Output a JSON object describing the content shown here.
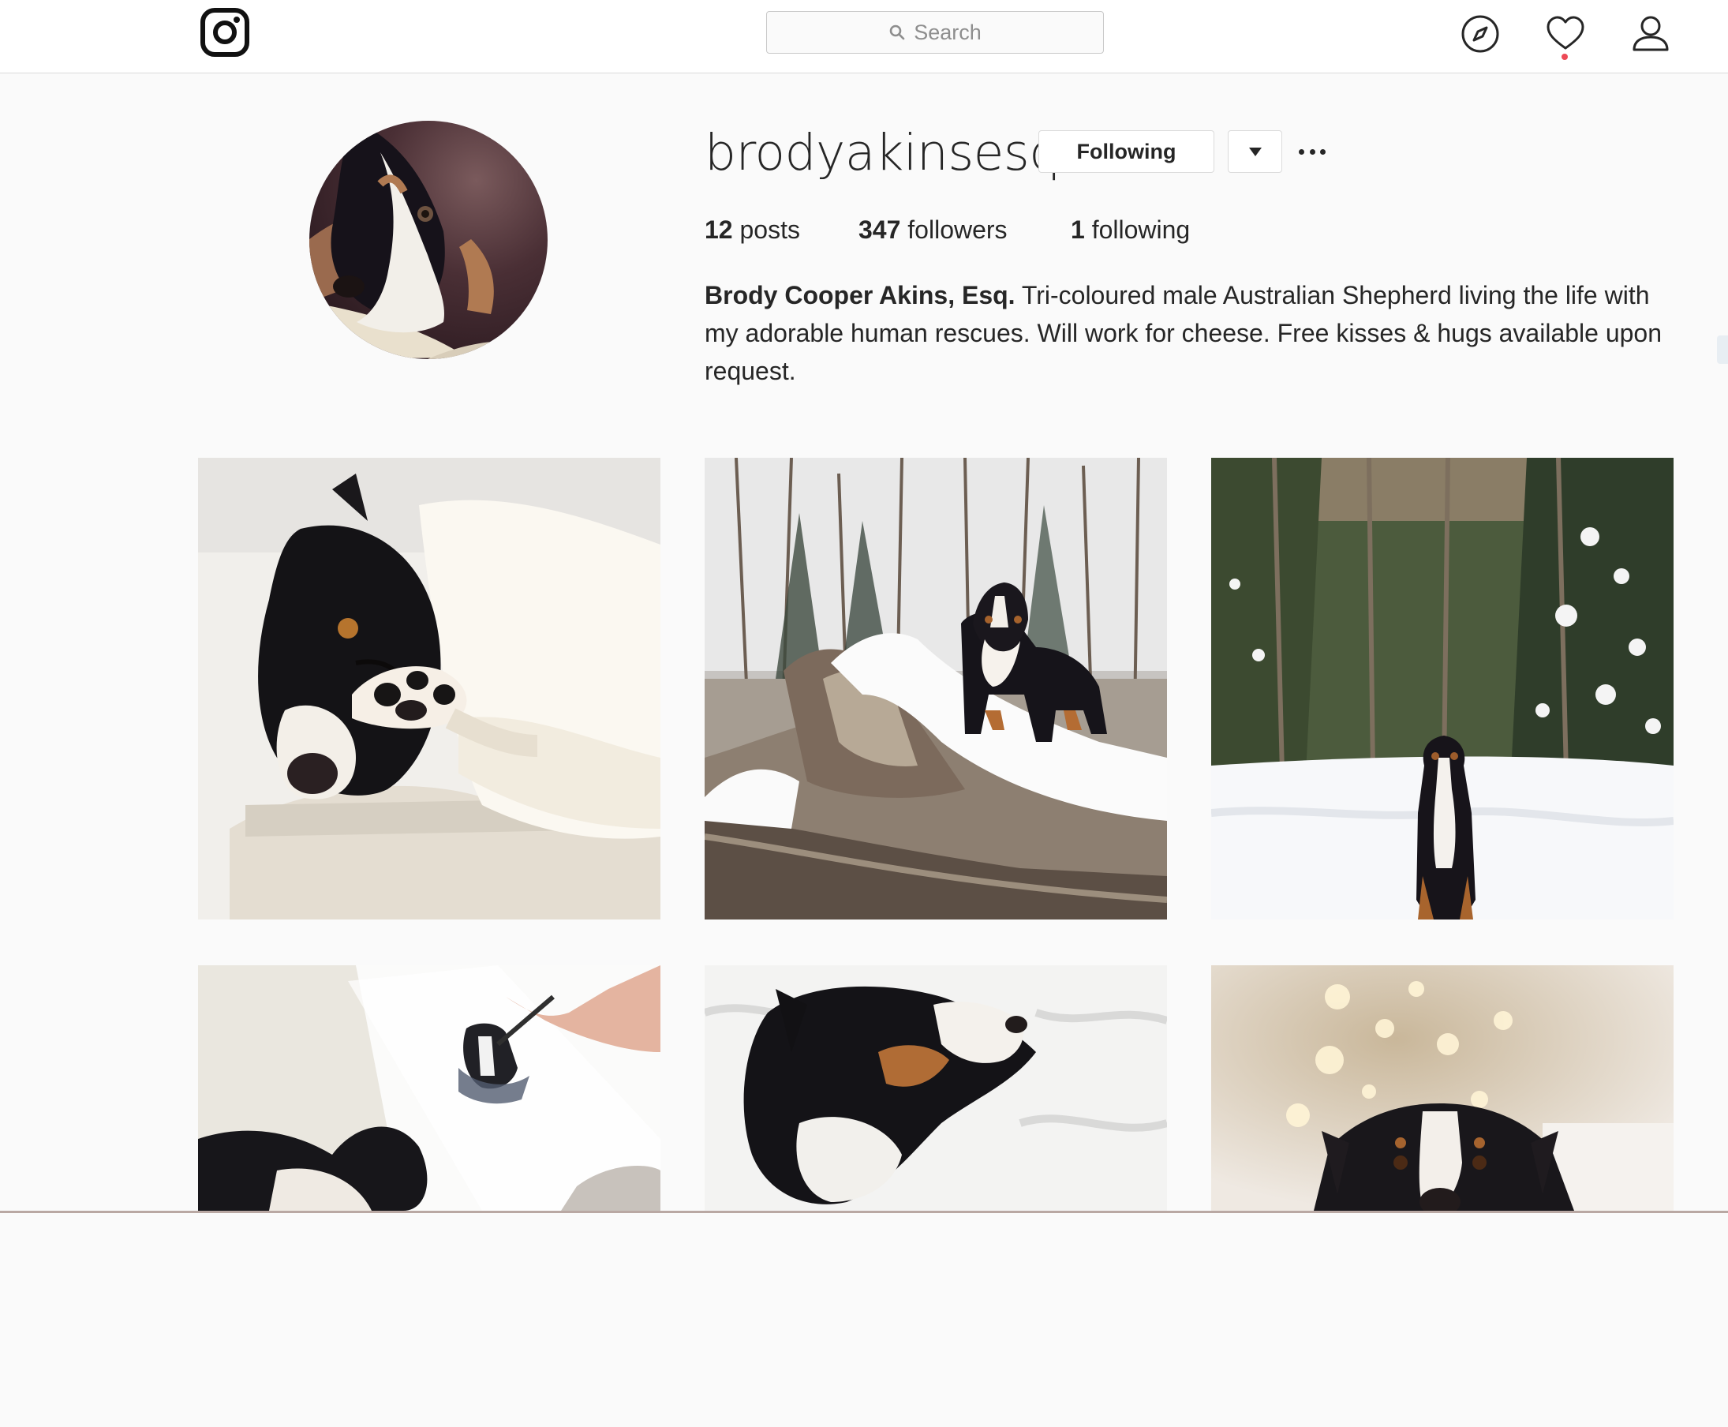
{
  "nav": {
    "search_placeholder": "Search",
    "logo_icon": "instagram-logo-icon",
    "icons": [
      "compass-icon",
      "heart-icon",
      "user-icon"
    ],
    "has_notification": true
  },
  "profile": {
    "username": "brodyakinsesq",
    "follow_button_label": "Following",
    "stats": {
      "posts_count": "12",
      "posts_label": " posts",
      "followers_count": "347",
      "followers_label": " followers",
      "following_count": "1",
      "following_label": " following"
    },
    "full_name": "Brody Cooper Akins, Esq.",
    "bio": " Tri-coloured male Australian Shepherd living the life with my adorable human rescues. Will work for cheese. Free kisses & hugs available upon request."
  },
  "posts": [
    {
      "subject": "dog-sleeping-blanket"
    },
    {
      "subject": "dog-on-snowy-log"
    },
    {
      "subject": "dog-sitting-in-snowy-forest"
    },
    {
      "subject": "hand-painting-dog-portrait"
    },
    {
      "subject": "dog-lying-in-bed"
    },
    {
      "subject": "dog-with-christmas-lights"
    }
  ],
  "colors": {
    "border": "#dbdbdb",
    "text": "#262626",
    "muted": "#8e8e8e",
    "notification": "#ed4956",
    "background": "#fafafa"
  }
}
